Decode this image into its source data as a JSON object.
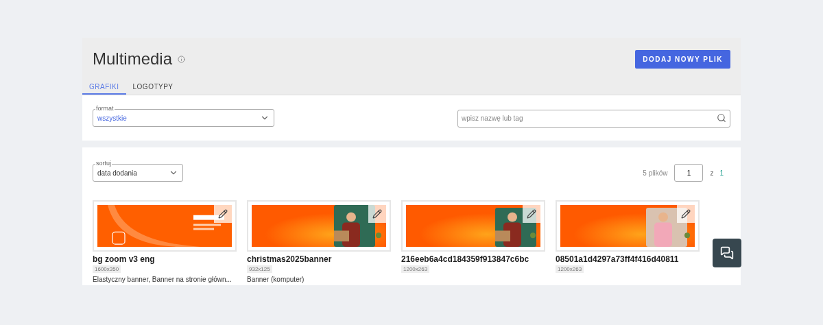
{
  "header": {
    "title": "Multimedia",
    "add_button": "DODAJ NOWY PLIK"
  },
  "tabs": [
    {
      "label": "GRAFIKI",
      "selected": true
    },
    {
      "label": "LOGOTYPY",
      "selected": false
    }
  ],
  "filters": {
    "format": {
      "label": "format",
      "value": "wszystkie"
    },
    "search": {
      "placeholder": "wpisz nazwę lub tag"
    }
  },
  "sort": {
    "label": "sortuj",
    "value": "data dodania"
  },
  "pagination": {
    "count": "5 plików",
    "page": "1",
    "of": "z",
    "total": "1"
  },
  "files": [
    {
      "name": "bg zoom v3 eng",
      "size": "1600x350",
      "tags": "Elastyczny banner, Banner na stronie główn..."
    },
    {
      "name": "christmas2025banner",
      "size": "932x125",
      "tags": "Banner (komputer)"
    },
    {
      "name": "216eeb6a4cd184359f913847c6bc",
      "size": "1200x263"
    },
    {
      "name": "08501a1d4297a73ff4f416d40811",
      "size": "1200x263"
    }
  ]
}
